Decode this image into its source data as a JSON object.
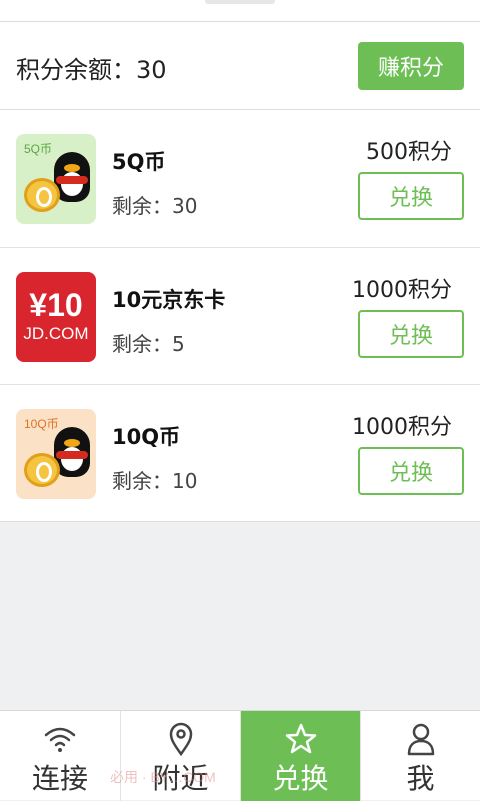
{
  "balance": {
    "label": "积分余额：30",
    "earn_button": "赚积分"
  },
  "items": [
    {
      "name": "5Q币",
      "remaining": "剩余：30",
      "price": "500积分",
      "button": "兑换",
      "thumb_tag": "5Q币",
      "thumb_icon": "qq-coin-icon"
    },
    {
      "name": "10元京东卡",
      "remaining": "剩余：5",
      "price": "1000积分",
      "button": "兑换",
      "thumb_big": "¥10",
      "thumb_small": "JD.COM",
      "thumb_icon": "jd-card-icon"
    },
    {
      "name": "10Q币",
      "remaining": "剩余：10",
      "price": "1000积分",
      "button": "兑换",
      "thumb_tag": "10Q币",
      "thumb_icon": "qq-coin-icon"
    }
  ],
  "tabs": [
    {
      "label": "连接",
      "icon": "wifi-icon"
    },
    {
      "label": "附近",
      "icon": "location-pin-icon"
    },
    {
      "label": "兑换",
      "icon": "star-icon",
      "active": true
    },
    {
      "label": "我",
      "icon": "person-icon"
    }
  ],
  "watermark": "必用 · BY…COM",
  "colors": {
    "accent": "#6dbf55",
    "jd_red": "#d9252d"
  }
}
